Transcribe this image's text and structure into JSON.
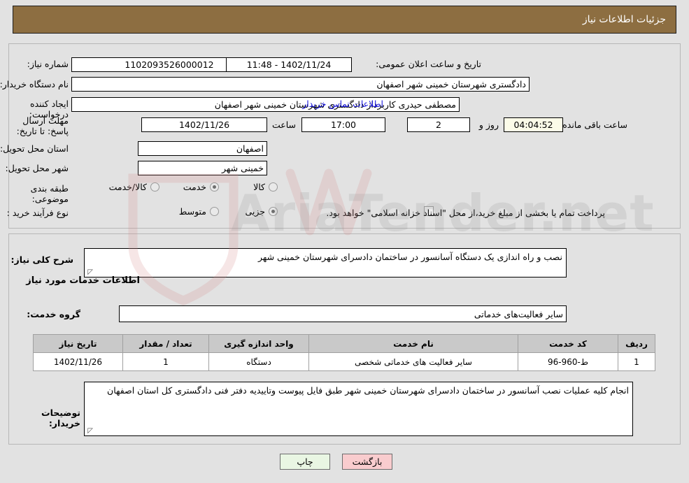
{
  "header": {
    "title": "جزئیات اطلاعات نیاز"
  },
  "form": {
    "need_number_label": "شماره نیاز:",
    "need_number_value": "1102093526000012",
    "announce_datetime_label": "تاریخ و ساعت اعلان عمومی:",
    "announce_datetime_value": "1402/11/24 - 11:48",
    "buyer_org_label": "نام دستگاه خریدار:",
    "buyer_org_value": "دادگستری شهرستان خمینی شهر اصفهان",
    "creator_label": "ایجاد کننده درخواست:",
    "creator_value": "مصطفی حیدری کاربرداز دادگستری شهرستان خمینی شهر اصفهان",
    "buyer_contact_link": "اطلاعات تماس خریدار",
    "deadline_label": "مهلت ارسال پاسخ: تا تاریخ:",
    "deadline_date": "1402/11/26",
    "hour_label": "ساعت",
    "hour_value": "17:00",
    "days_value": "2",
    "days_label": "روز و",
    "remaining_time": "04:04:52",
    "remaining_label": "ساعت باقی مانده",
    "province_label": "استان محل تحویل:",
    "province_value": "اصفهان",
    "city_label": "شهر محل تحویل:",
    "city_value": "خمینی شهر",
    "category_label": "طبقه بندی موضوعی:",
    "category_options": [
      {
        "label": "کالا",
        "selected": false
      },
      {
        "label": "خدمت",
        "selected": true
      },
      {
        "label": "کالا/خدمت",
        "selected": false
      }
    ],
    "purchase_type_label": "نوع فرآیند خرید :",
    "purchase_type_options": [
      {
        "label": "جزیی",
        "selected": true
      },
      {
        "label": "متوسط",
        "selected": false
      }
    ],
    "treasury_note": "پرداخت تمام یا بخشی از مبلغ خرید،از محل \"اسناد خزانه اسلامی\" خواهد بود."
  },
  "details": {
    "general_desc_label": "شرح کلی نیاز:",
    "general_desc_value": "نصب و راه اندازی یک دستگاه آسانسور در ساختمان دادسرای شهرستان خمینی شهر",
    "services_section_title": "اطلاعات خدمات مورد نیاز",
    "service_group_label": "گروه خدمت:",
    "service_group_value": "سایر فعالیت‌های خدماتی",
    "table": {
      "columns": [
        "ردیف",
        "کد خدمت",
        "نام خدمت",
        "واحد اندازه گیری",
        "تعداد / مقدار",
        "تاریخ نیاز"
      ],
      "rows": [
        [
          "1",
          "ط-960-96",
          "سایر فعالیت های خدماتی شخصی",
          "دستگاه",
          "1",
          "1402/11/26"
        ]
      ]
    },
    "buyer_notes_label": "توضیحات خریدار:",
    "buyer_notes_value": "انجام کلیه عملیات نصب آسانسور در ساختمان دادسرای شهرستان خمینی شهر  طبق فایل پیوست وتاییدیه دفتر فنی دادگستری کل استان اصفهان"
  },
  "footer": {
    "print_label": "چاپ",
    "back_label": "بازگشت"
  },
  "watermark": {
    "text": "AriaTender.net"
  },
  "colors": {
    "header_bg": "#8d6e41",
    "page_bg": "#e2e2e2",
    "link": "#1a18e0",
    "print_btn": "#e9f6e3",
    "back_btn": "#f9ccce",
    "highlight_field": "#fbfbe8"
  }
}
